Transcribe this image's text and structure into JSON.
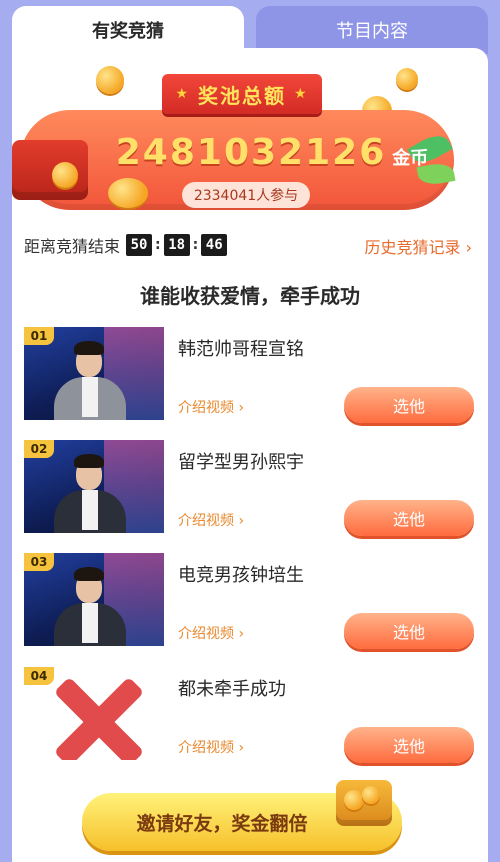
{
  "tabs": [
    {
      "label": "有奖竞猜",
      "active": true
    },
    {
      "label": "节目内容",
      "active": false
    }
  ],
  "banner": {
    "title": "奖池总额",
    "amount": "2481032126",
    "unit": "金币",
    "participants": "2334041人参与"
  },
  "timer": {
    "label": "距离竞猜结束",
    "hours": "50",
    "minutes": "18",
    "seconds": "46"
  },
  "history_link": "历史竞猜记录 ›",
  "question": "谁能收获爱情，牵手成功",
  "options": [
    {
      "num": "01",
      "name": "韩范帅哥程宣铭",
      "intro": "介绍视频 ›",
      "button": "选他"
    },
    {
      "num": "02",
      "name": "留学型男孙熙宇",
      "intro": "介绍视频 ›",
      "button": "选他"
    },
    {
      "num": "03",
      "name": "电竞男孩钟培生",
      "intro": "介绍视频 ›",
      "button": "选他"
    },
    {
      "num": "04",
      "name": "都未牵手成功",
      "intro": "介绍视频 ›",
      "button": "选他"
    }
  ],
  "invite": "邀请好友，奖金翻倍",
  "colors": {
    "background": "#a6acf0",
    "accent": "#ff6b3e",
    "link": "#e86a2c"
  }
}
